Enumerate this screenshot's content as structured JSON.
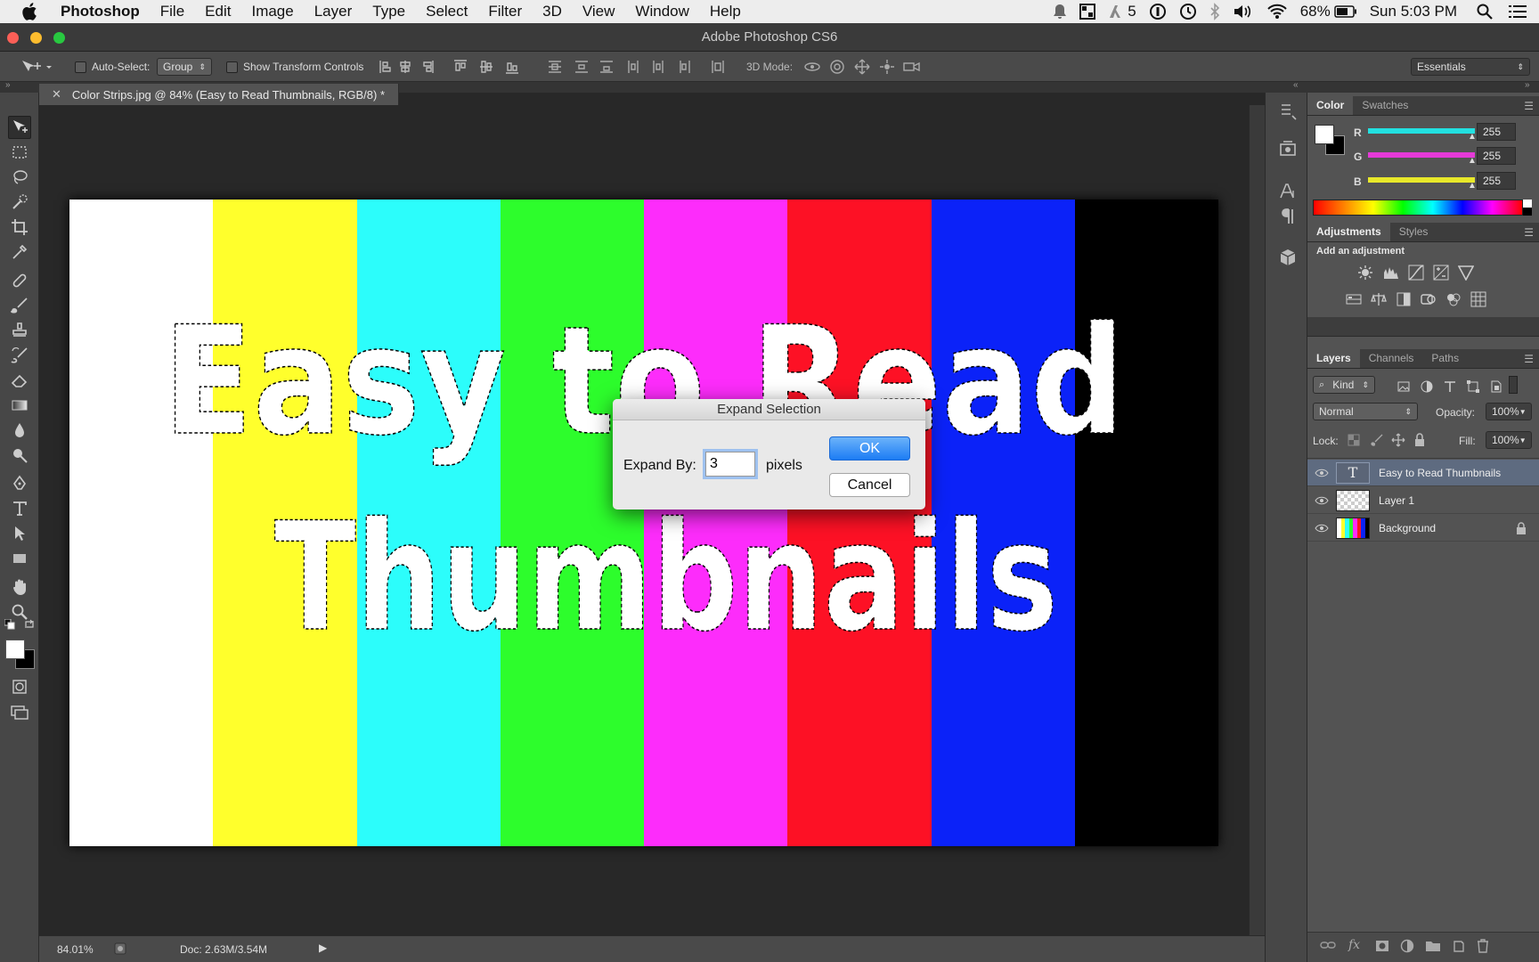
{
  "menubar": {
    "app_name": "Photoshop",
    "items": [
      "File",
      "Edit",
      "Image",
      "Layer",
      "Type",
      "Select",
      "Filter",
      "3D",
      "View",
      "Window",
      "Help"
    ],
    "status": {
      "num": "5",
      "battery": "68%",
      "clock": "Sun 5:03 PM"
    }
  },
  "window": {
    "title": "Adobe Photoshop CS6"
  },
  "options": {
    "auto_select_label": "Auto-Select:",
    "auto_select_value": "Group",
    "transform_label": "Show Transform Controls",
    "mode_3d_label": "3D Mode:",
    "workspace": "Essentials"
  },
  "document": {
    "tab_title": "Color Strips.jpg @ 84% (Easy to Read Thumbnails, RGB/8) *"
  },
  "canvas": {
    "strip_colors": [
      "#ffffff",
      "#ffff2c",
      "#2cfdfb",
      "#2dfd2c",
      "#fd2cfb",
      "#fd1125",
      "#0b22f8",
      "#000000"
    ],
    "line1": "Easy to Read",
    "line2": "Thumbnails"
  },
  "status": {
    "zoom": "84.01%",
    "doc": "Doc: 2.63M/3.54M"
  },
  "color_panel": {
    "tabs": [
      "Color",
      "Swatches"
    ],
    "channels": [
      {
        "label": "R",
        "value": "255",
        "color": "#22e0e0"
      },
      {
        "label": "G",
        "value": "255",
        "color": "#e53ad8"
      },
      {
        "label": "B",
        "value": "255",
        "color": "#e8e82a"
      }
    ]
  },
  "adjustments_panel": {
    "tabs": [
      "Adjustments",
      "Styles"
    ],
    "heading": "Add an adjustment"
  },
  "layers_panel": {
    "tabs": [
      "Layers",
      "Channels",
      "Paths"
    ],
    "kind_label": "Kind",
    "blend_mode": "Normal",
    "opacity_label": "Opacity:",
    "opacity_value": "100%",
    "lock_label": "Lock:",
    "fill_label": "Fill:",
    "fill_value": "100%",
    "layers": [
      {
        "name": "Easy to Read Thumbnails",
        "type": "text",
        "selected": true
      },
      {
        "name": "Layer 1",
        "type": "pixel",
        "selected": false
      },
      {
        "name": "Background",
        "type": "image",
        "selected": false,
        "locked": true
      }
    ]
  },
  "dialog": {
    "title": "Expand Selection",
    "label": "Expand By:",
    "value": "3",
    "unit": "pixels",
    "ok": "OK",
    "cancel": "Cancel"
  }
}
